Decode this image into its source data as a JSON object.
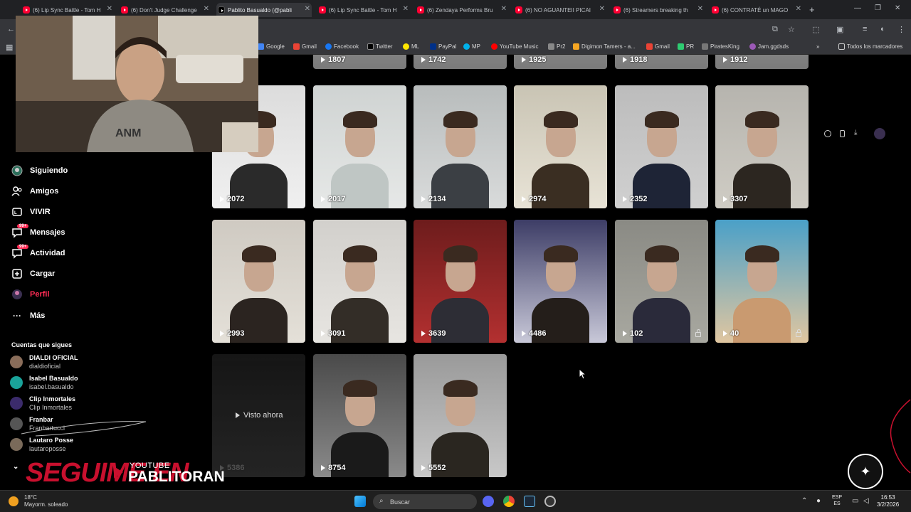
{
  "browser": {
    "tabs": [
      {
        "title": "(6) Lip Sync Battle - Tom H",
        "active": false
      },
      {
        "title": "(6) Don't Judge Challenge",
        "active": false
      },
      {
        "title": "Pablito Basualdo (@pabli",
        "active": true
      },
      {
        "title": "(6) Lip Sync Battle - Tom H",
        "active": false
      },
      {
        "title": "(6) Zendaya Performs Bru",
        "active": false
      },
      {
        "title": "(6) NO AGUANTEII PICAI",
        "active": false
      },
      {
        "title": "(6) Streamers breaking th",
        "active": false
      },
      {
        "title": "(6) CONTRATÉ un MAGO",
        "active": false
      }
    ],
    "bookmarks": [
      {
        "label": "Google",
        "color": "#4285f4"
      },
      {
        "label": "Gmail",
        "color": "#ea4335"
      },
      {
        "label": "Facebook",
        "color": "#1877f2"
      },
      {
        "label": "Twitter",
        "color": "#000000"
      },
      {
        "label": "ML",
        "color": "#ffe600"
      },
      {
        "label": "PayPal",
        "color": "#003087"
      },
      {
        "label": "MP",
        "color": "#00b1ea"
      },
      {
        "label": "YouTube Music",
        "color": "#ff0000"
      },
      {
        "label": "Pr2",
        "color": "#888888"
      },
      {
        "label": "Digimon Tamers - a...",
        "color": "#f5a623"
      },
      {
        "label": "Gmail",
        "color": "#ea4335"
      },
      {
        "label": "PR",
        "color": "#2ecc71"
      },
      {
        "label": "PiratesKing",
        "color": "#777777"
      },
      {
        "label": "Jam.ggdsds",
        "color": "#9b59b6"
      }
    ],
    "all_bookmarks": "Todos los marcadores"
  },
  "sidebar": {
    "nav": [
      {
        "label": "Siguiendo",
        "icon": "following-icon",
        "active": false,
        "badge": ""
      },
      {
        "label": "Amigos",
        "icon": "friends-icon",
        "active": false,
        "badge": ""
      },
      {
        "label": "VIVIR",
        "icon": "live-icon",
        "active": false,
        "badge": ""
      },
      {
        "label": "Mensajes",
        "icon": "messages-icon",
        "active": false,
        "badge": "99+"
      },
      {
        "label": "Actividad",
        "icon": "activity-icon",
        "active": false,
        "badge": "99+"
      },
      {
        "label": "Cargar",
        "icon": "upload-icon",
        "active": false,
        "badge": ""
      },
      {
        "label": "Perfil",
        "icon": "profile-icon",
        "active": true,
        "badge": ""
      },
      {
        "label": "Más",
        "icon": "more-icon",
        "active": false,
        "badge": ""
      }
    ],
    "following_title": "Cuentas que sigues",
    "following": [
      {
        "name": "DIALDI OFICIAL",
        "handle": "dialdioficial",
        "color": "#8a6d5a"
      },
      {
        "name": "Isabel Basualdo",
        "handle": "isabel.basualdo",
        "color": "#1aa39a"
      },
      {
        "name": "Clip Inmortales",
        "handle": "Clip Inmortales",
        "color": "#3b2b6b"
      },
      {
        "name": "Franbar",
        "handle": "Franbartucci",
        "color": "#555555"
      },
      {
        "name": "Lautaro Posse",
        "handle": "lautaroposse",
        "color": "#7a6a5a"
      }
    ]
  },
  "grid": {
    "top_row_views": [
      "1807",
      "1742",
      "1925",
      "1918",
      "1912"
    ],
    "rows": [
      [
        {
          "views": "2072",
          "locked": false
        },
        {
          "views": "2017",
          "locked": false
        },
        {
          "views": "2134",
          "locked": false
        },
        {
          "views": "2974",
          "locked": false
        },
        {
          "views": "2352",
          "locked": false
        },
        {
          "views": "3307",
          "locked": false
        }
      ],
      [
        {
          "views": "2993",
          "locked": false
        },
        {
          "views": "3091",
          "locked": false
        },
        {
          "views": "3639",
          "locked": false
        },
        {
          "views": "4486",
          "locked": false
        },
        {
          "views": "102",
          "locked": true
        },
        {
          "views": "40",
          "locked": true
        }
      ],
      [
        {
          "views": "5386",
          "locked": false
        },
        {
          "views": "8754",
          "locked": false
        },
        {
          "views": "5552",
          "locked": false
        }
      ]
    ],
    "visto_ahora": "Visto ahora"
  },
  "overlay": {
    "cta": "SEGUIME EN",
    "platform": "YOUTUBE",
    "channel": "PABLITORAN"
  },
  "taskbar": {
    "temp": "18°C",
    "weather": "Mayorm. soleado",
    "search": "Buscar",
    "lang1": "ESP",
    "lang2": "ES",
    "time": "16:53",
    "date": "3/2/2026"
  }
}
